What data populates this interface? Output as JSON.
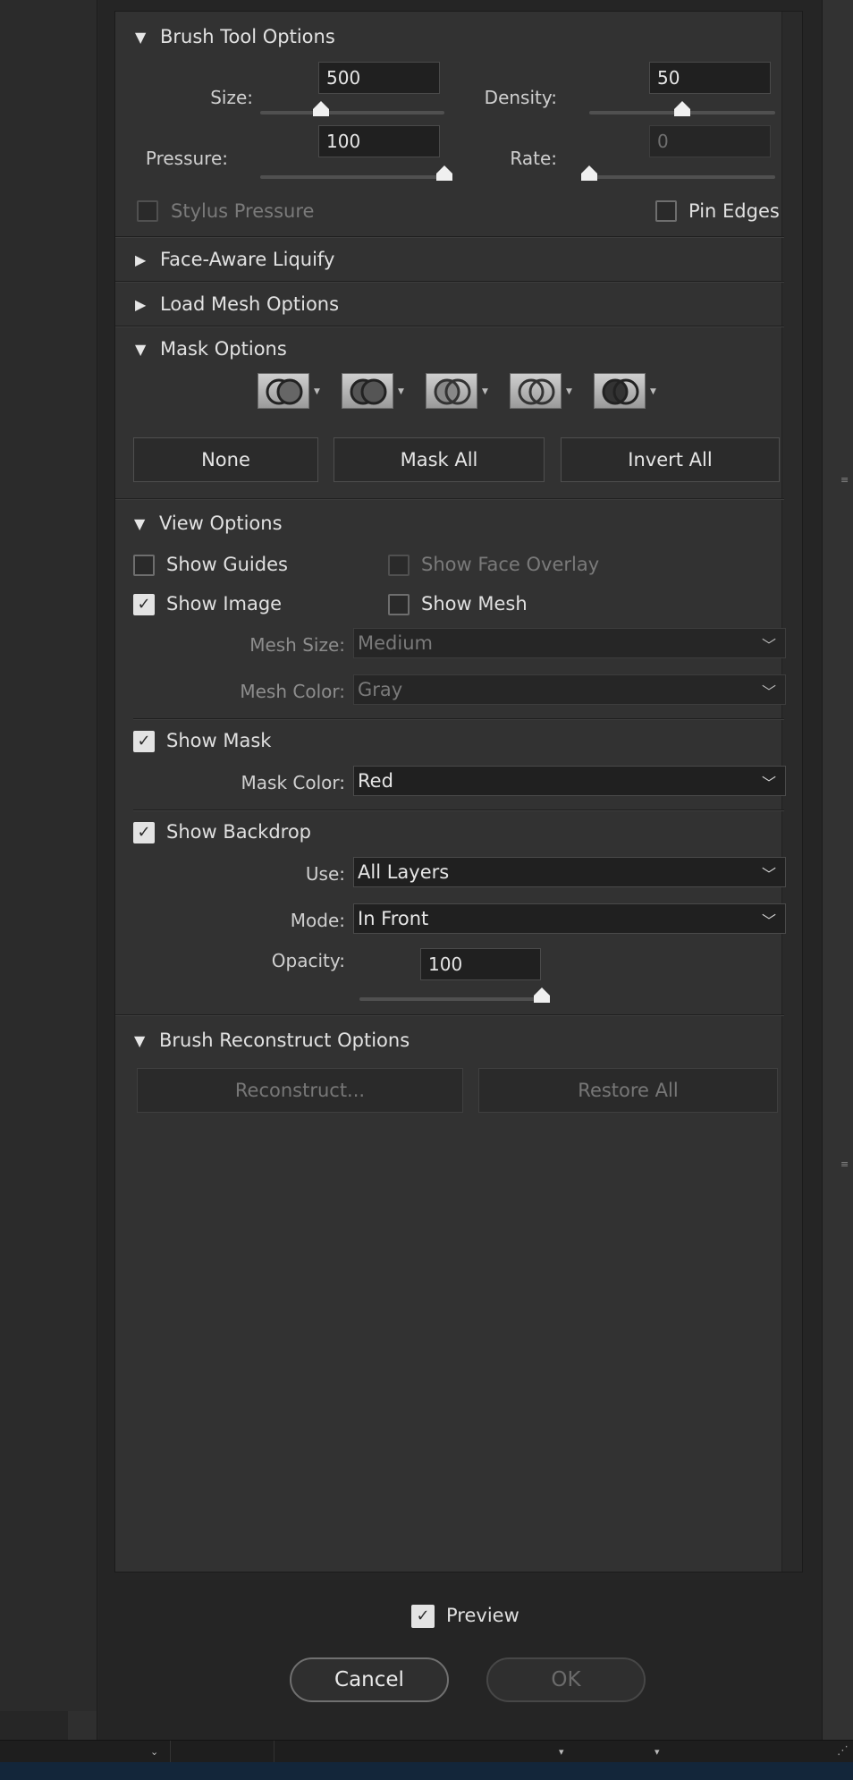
{
  "brush_tool": {
    "title": "Brush Tool Options",
    "size_label": "Size:",
    "size_value": "500",
    "density_label": "Density:",
    "density_value": "50",
    "pressure_label": "Pressure:",
    "pressure_value": "100",
    "rate_label": "Rate:",
    "rate_value": "0",
    "stylus_pressure_label": "Stylus Pressure",
    "pin_edges_label": "Pin Edges",
    "size_slider_fraction": 0.33,
    "density_slider_fraction": 0.5,
    "pressure_slider_fraction": 1.0,
    "rate_slider_fraction": 0.0
  },
  "face_aware": {
    "title": "Face-Aware Liquify"
  },
  "load_mesh": {
    "title": "Load Mesh Options"
  },
  "mask_options": {
    "title": "Mask Options",
    "none_label": "None",
    "mask_all_label": "Mask All",
    "invert_all_label": "Invert All",
    "icons": [
      "mask-replace-icon",
      "mask-add-icon",
      "mask-subtract-icon",
      "mask-intersect-icon",
      "mask-invert-icon"
    ]
  },
  "view_options": {
    "title": "View Options",
    "show_guides_label": "Show Guides",
    "show_face_overlay_label": "Show Face Overlay",
    "show_image_label": "Show Image",
    "show_mesh_label": "Show Mesh",
    "mesh_size_label": "Mesh Size:",
    "mesh_size_value": "Medium",
    "mesh_color_label": "Mesh Color:",
    "mesh_color_value": "Gray",
    "show_mask_label": "Show Mask",
    "mask_color_label": "Mask Color:",
    "mask_color_value": "Red",
    "show_backdrop_label": "Show Backdrop",
    "use_label": "Use:",
    "use_value": "All Layers",
    "mode_label": "Mode:",
    "mode_value": "In Front",
    "opacity_label": "Opacity:",
    "opacity_value": "100",
    "opacity_slider_fraction": 1.0
  },
  "reconstruct": {
    "title": "Brush Reconstruct Options",
    "reconstruct_label": "Reconstruct...",
    "restore_all_label": "Restore All"
  },
  "footer": {
    "preview_label": "Preview",
    "cancel_label": "Cancel",
    "ok_label": "OK"
  },
  "colors": {
    "panel_bg": "#323232",
    "page_bg": "#252525",
    "text": "#dedede",
    "dim_text": "#7a7a7a"
  }
}
